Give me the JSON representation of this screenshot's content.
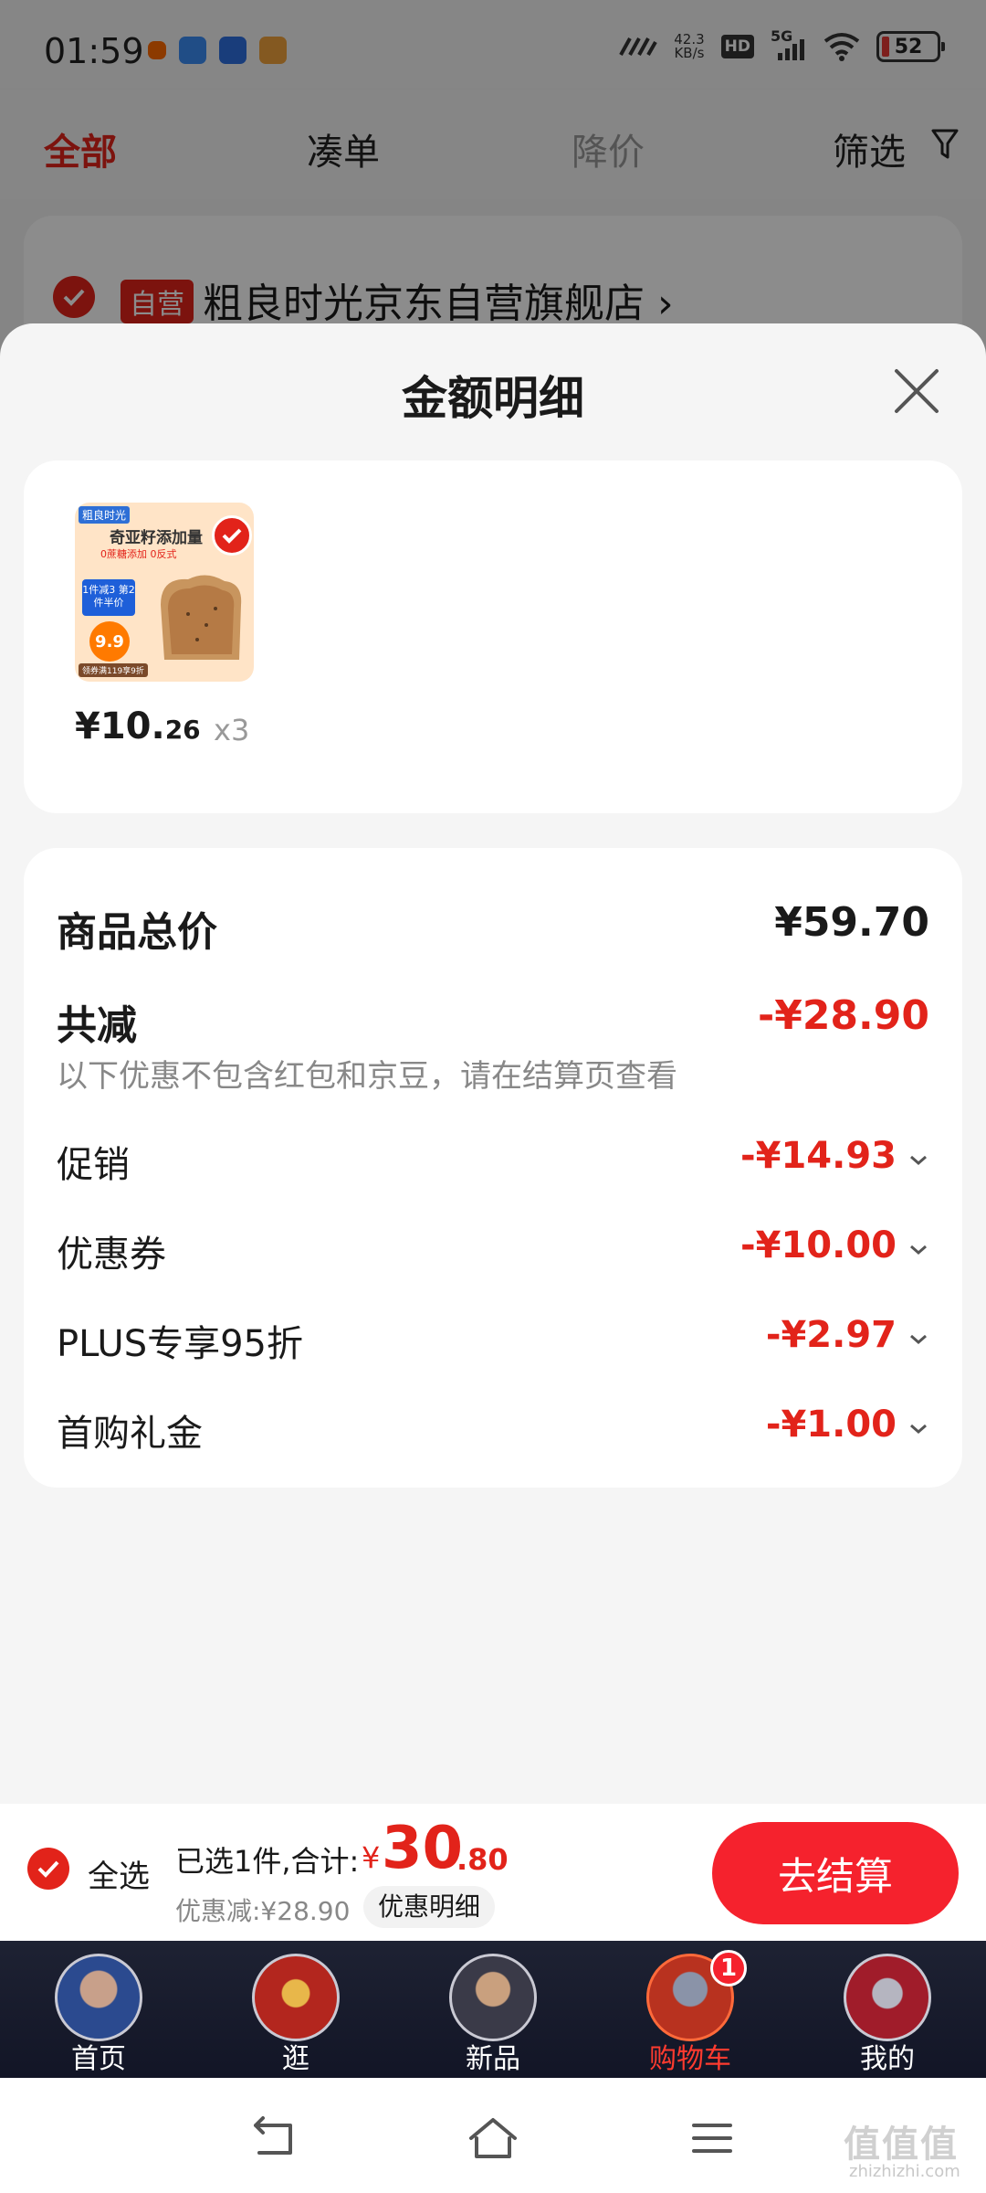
{
  "status_bar": {
    "time": "01:59",
    "net_speed_top": "42.3",
    "net_speed_bottom": "KB/s",
    "hd": "HD",
    "network": "5G",
    "battery": "52"
  },
  "top_tabs": {
    "all": "全部",
    "combine": "凑单",
    "price_drop": "降价",
    "filter": "筛选"
  },
  "store": {
    "badge": "自营",
    "name": "粗良时光京东自营旗舰店 ›"
  },
  "sheet": {
    "title": "金额明细",
    "product": {
      "image_brand": "粗良时光",
      "image_headline": "奇亚籽添加量",
      "image_tags": "0蔗糖添加 0反式",
      "image_promo": "1件减3 第2件半价",
      "image_price_badge": "9.9",
      "image_bottom": "领券满119享9折",
      "price_int": "¥10.",
      "price_dec": "26",
      "qty": "x3"
    },
    "rows": {
      "total_label": "商品总价",
      "total_value": "¥59.70",
      "reduce_label": "共减",
      "reduce_value": "-¥28.90",
      "reduce_note": "以下优惠不包含红包和京豆，请在结算页查看",
      "promo_label": "促销",
      "promo_value": "-¥14.93",
      "coupon_label": "优惠券",
      "coupon_value": "-¥10.00",
      "plus_label": "PLUS专享95折",
      "plus_value": "-¥2.97",
      "first_label": "首购礼金",
      "first_value": "-¥1.00"
    }
  },
  "checkout": {
    "select_all": "全选",
    "selected": "已选1件,合计:",
    "yen": "¥",
    "total_int": "30",
    "total_dec": ".80",
    "discount": "优惠减:¥28.90",
    "detail_button": "优惠明细",
    "pay_button": "去结算"
  },
  "tabbar": {
    "home": "首页",
    "browse": "逛",
    "new": "新品",
    "cart": "购物车",
    "cart_badge": "1",
    "mine": "我的"
  },
  "watermark": {
    "main": "值值值",
    "sub": "zhizhizhi.com"
  },
  "colors": {
    "accent": "#e2231a",
    "pay_button": "#f5222d",
    "tabbar": "#1e2233"
  }
}
